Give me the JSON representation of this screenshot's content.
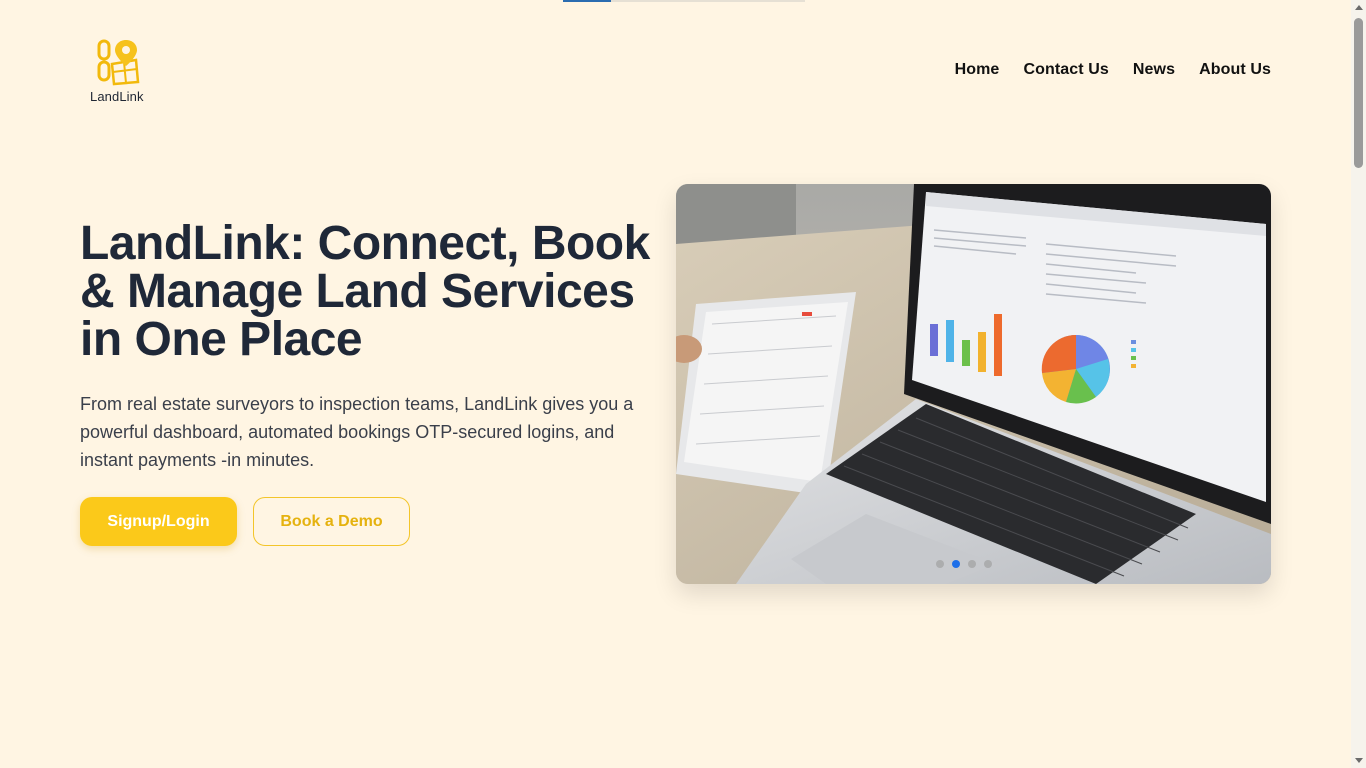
{
  "brand": {
    "name": "LandLink",
    "accent": "#fbc91a",
    "background": "#fff5e3"
  },
  "nav": {
    "items": [
      {
        "label": "Home"
      },
      {
        "label": "Contact Us"
      },
      {
        "label": "News"
      },
      {
        "label": "About Us"
      }
    ]
  },
  "hero": {
    "title": "LandLink: Connect, Book & Manage Land Services in One Place",
    "description": "From real estate surveyors to inspection teams, LandLink gives you a powerful dashboard, automated bookings OTP-secured logins, and instant payments -in minutes.",
    "primary_button": "Signup/Login",
    "secondary_button": "Book a Demo",
    "carousel": {
      "slides": 4,
      "active_index": 1
    }
  },
  "icons": {
    "logo": "map-pin-logo-icon",
    "carousel_dot": "carousel-dot-icon"
  }
}
